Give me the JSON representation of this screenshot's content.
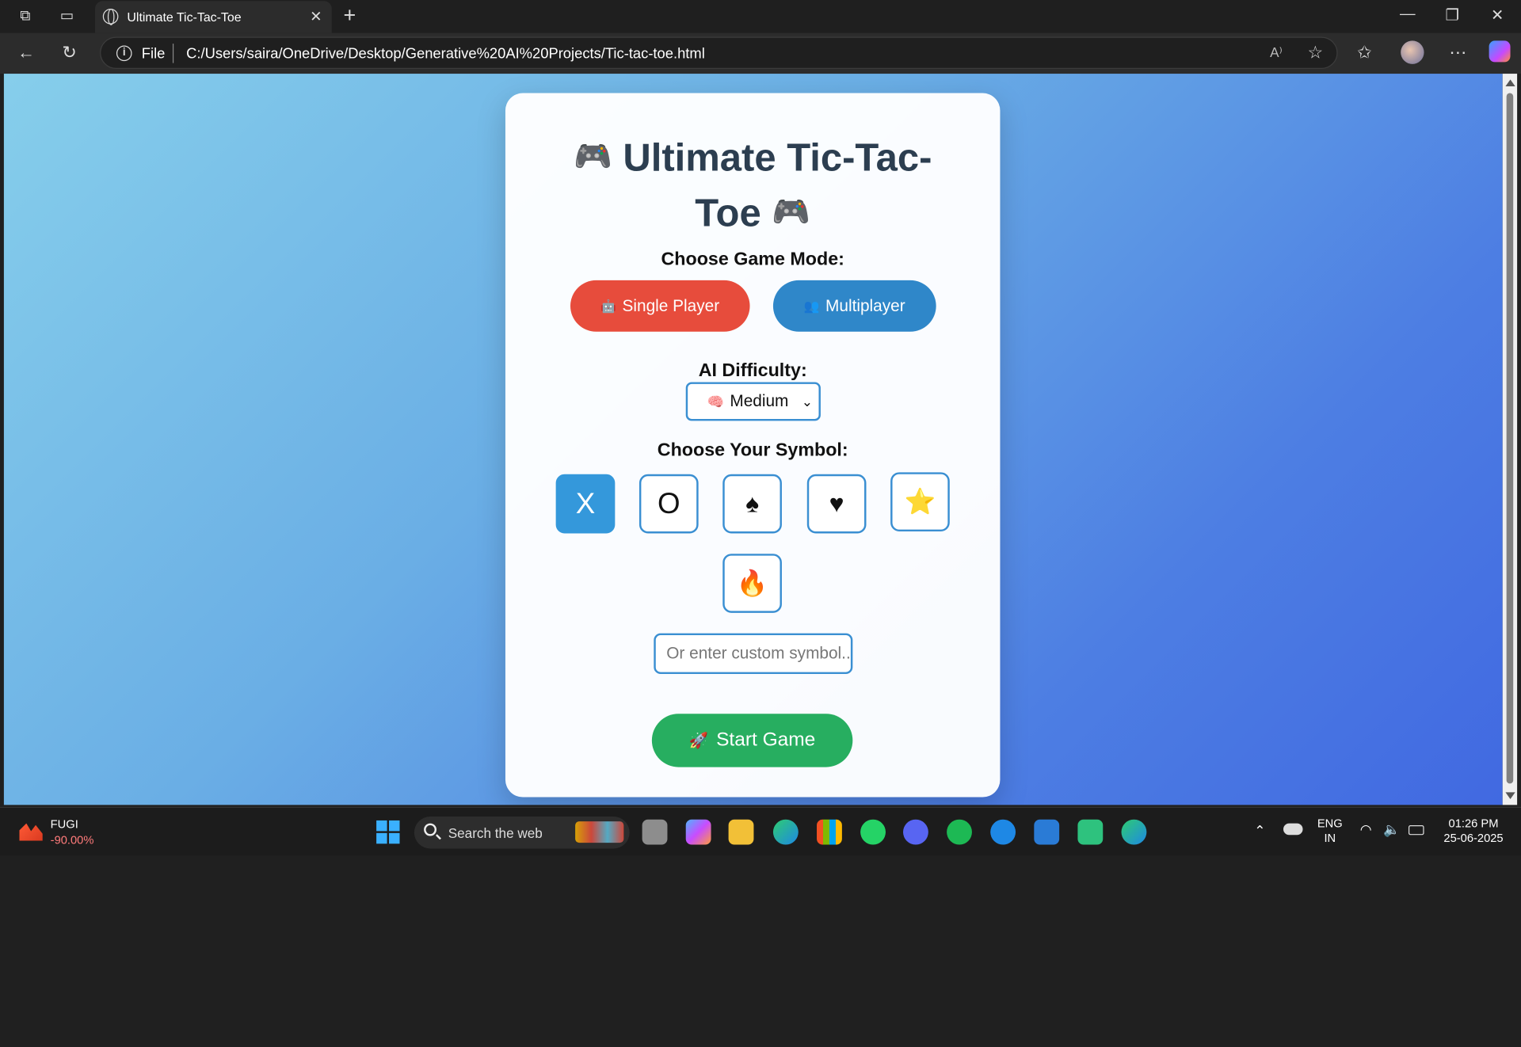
{
  "browser": {
    "tab_title": "Ultimate Tic-Tac-Toe",
    "address_prefix": "File",
    "url": "C:/Users/saira/OneDrive/Desktop/Generative%20AI%20Projects/Tic-tac-toe.html",
    "read_aloud_label": "A⁾"
  },
  "page": {
    "title_line1": "Ultimate Tic-Tac-",
    "title_line2": "Toe",
    "title_emoji": "🎮",
    "mode_label": "Choose Game Mode:",
    "single_player": {
      "icon": "🤖",
      "label": "Single Player"
    },
    "multiplayer": {
      "icon": "👥",
      "label": "Multiplayer"
    },
    "difficulty_label": "AI Difficulty:",
    "difficulty": {
      "icon": "🧠",
      "value": "Medium"
    },
    "symbol_label": "Choose Your Symbol:",
    "symbols": [
      "X",
      "O",
      "♠",
      "♥",
      "⭐",
      "🔥"
    ],
    "selected_symbol": "X",
    "custom_placeholder": "Or enter custom symbol...",
    "start": {
      "icon": "🚀",
      "label": "Start Game"
    }
  },
  "taskbar": {
    "weather_title": "FUGI",
    "weather_value": "-90.00%",
    "search_placeholder": "Search the web",
    "lang_line1": "ENG",
    "lang_line2": "IN",
    "time": "01:26 PM",
    "date": "25-06-2025"
  },
  "colors": {
    "single_player": "#e74c3c",
    "multiplayer": "#2f87c9",
    "selected_symbol": "#3498db",
    "start": "#27ae60",
    "title": "#2c3e50"
  }
}
